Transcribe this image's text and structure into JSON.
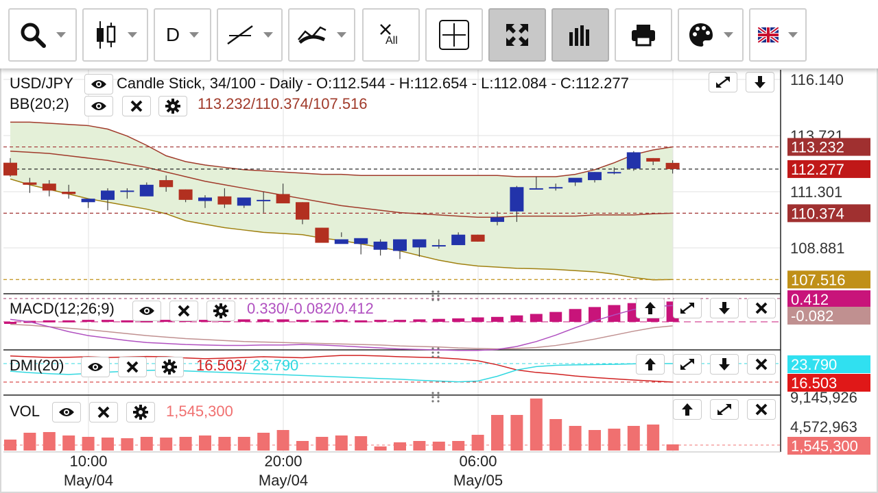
{
  "toolbar": {
    "timeframe_label": "D",
    "multi_all_label": "All",
    "buttons": [
      "search-tool",
      "chart-type",
      "timeframe",
      "drawing-tools",
      "indicators",
      "clear-all",
      "crosshair",
      "fullscreen",
      "volume-bars",
      "print",
      "theme",
      "language"
    ]
  },
  "header": {
    "symbol_line": "USD/JPY",
    "info_line": "Candle Stick, 34/100 - Daily - O:112.544 - H:112.654 - L:112.084 - C:112.277"
  },
  "indicators": {
    "bb": {
      "label": "BB(20;2)",
      "values": "113.232/110.374/107.516"
    },
    "macd": {
      "label": "MACD(12;26;9)",
      "values": "0.330/-0.082/0.412"
    },
    "dmi": {
      "label": "DMI(20)",
      "values_red": "16.503/",
      "values_cyan": "23.790"
    },
    "vol": {
      "label": "VOL",
      "values": "1,545,300"
    }
  },
  "colors": {
    "up": "#2233aa",
    "down": "#b23020",
    "upper_band": "#a03a2a",
    "middle_band": "#a03a2a",
    "lower_band": "#a08010",
    "band_fill": "#e4f0d8",
    "macd_line": "#b050c0",
    "signal_line": "#c09090",
    "histogram": "#c8147a",
    "dmi_plus": "#30d8e0",
    "dmi_minus": "#d02020",
    "volume": "#f07070"
  },
  "chart_data": {
    "type": "candlestick",
    "price_axis_ticks": [
      "116.140",
      "113.721",
      "111.301",
      "108.881"
    ],
    "price_tags": [
      {
        "label": "113.232",
        "value": 113.232,
        "color": "#a03030"
      },
      {
        "label": "112.277",
        "value": 112.277,
        "color": "#c01818"
      },
      {
        "label": "110.374",
        "value": 110.374,
        "color": "#a03030"
      },
      {
        "label": "107.516",
        "value": 107.516,
        "color": "#c09018"
      }
    ],
    "macd_tags": [
      {
        "label": "0.412",
        "color": "#c8147a"
      },
      {
        "label": "-0.082",
        "color": "#c09090"
      }
    ],
    "dmi_tags": [
      {
        "label": "23.790",
        "color": "#30e0f0"
      },
      {
        "label": "16.503",
        "color": "#e01818"
      }
    ],
    "vol_axis_ticks": [
      "9,145,926",
      "4,572,963"
    ],
    "vol_tag": {
      "label": "1,545,300",
      "color": "#f07070"
    },
    "time_ticks": [
      {
        "time": "10:00",
        "date": "May/04"
      },
      {
        "time": "20:00",
        "date": "May/04"
      },
      {
        "time": "06:00",
        "date": "May/05"
      }
    ],
    "ohlc": [
      [
        112.55,
        112.75,
        111.95,
        112.0
      ],
      [
        111.7,
        111.9,
        111.25,
        111.6
      ],
      [
        111.65,
        111.8,
        111.1,
        111.35
      ],
      [
        111.3,
        111.6,
        111.0,
        111.2
      ],
      [
        110.85,
        111.0,
        110.6,
        111.0
      ],
      [
        110.95,
        111.45,
        110.5,
        111.35
      ],
      [
        111.3,
        111.45,
        111.0,
        111.35
      ],
      [
        111.1,
        111.7,
        111.2,
        111.6
      ],
      [
        111.8,
        112.0,
        111.3,
        111.5
      ],
      [
        111.4,
        111.4,
        110.85,
        110.95
      ],
      [
        110.9,
        111.15,
        110.6,
        111.05
      ],
      [
        111.1,
        111.45,
        110.6,
        110.75
      ],
      [
        110.7,
        111.0,
        110.6,
        111.05
      ],
      [
        110.9,
        111.3,
        110.4,
        110.95
      ],
      [
        111.2,
        111.65,
        110.85,
        110.8
      ],
      [
        110.85,
        110.85,
        109.9,
        110.1
      ],
      [
        109.75,
        109.75,
        109.3,
        109.1
      ],
      [
        109.05,
        109.55,
        109.35,
        109.25
      ],
      [
        109.05,
        109.25,
        108.6,
        109.3
      ],
      [
        108.8,
        109.25,
        108.55,
        109.15
      ],
      [
        108.75,
        109.25,
        108.4,
        109.25
      ],
      [
        108.9,
        109.25,
        108.5,
        109.25
      ],
      [
        108.95,
        109.25,
        108.85,
        109.0
      ],
      [
        109.0,
        109.55,
        109.0,
        109.45
      ],
      [
        109.45,
        109.45,
        109.15,
        109.15
      ],
      [
        110.0,
        110.45,
        109.85,
        110.2
      ],
      [
        110.45,
        111.55,
        110.0,
        111.5
      ],
      [
        111.45,
        111.95,
        111.4,
        111.45
      ],
      [
        111.45,
        111.65,
        111.35,
        111.5
      ],
      [
        111.7,
        111.85,
        111.55,
        111.9
      ],
      [
        111.8,
        112.15,
        111.7,
        112.15
      ],
      [
        112.15,
        112.35,
        112.05,
        112.15
      ],
      [
        112.3,
        113.05,
        112.2,
        113.0
      ],
      [
        112.75,
        112.75,
        112.45,
        112.6
      ],
      [
        112.544,
        112.654,
        112.084,
        112.277
      ]
    ],
    "bb_upper": [
      114.3,
      114.3,
      114.25,
      114.2,
      114.15,
      114.0,
      113.7,
      113.3,
      112.85,
      112.6,
      112.45,
      112.35,
      112.25,
      112.2,
      112.15,
      112.1,
      112.05,
      112.05,
      112.0,
      112.0,
      112.0,
      112.0,
      112.0,
      112.0,
      112.0,
      112.0,
      111.95,
      111.95,
      111.95,
      112.05,
      112.25,
      112.55,
      112.9,
      113.1,
      113.232
    ],
    "bb_middle": [
      113.05,
      113.0,
      112.95,
      112.85,
      112.75,
      112.65,
      112.5,
      112.35,
      112.15,
      111.95,
      111.75,
      111.6,
      111.45,
      111.3,
      111.15,
      111.0,
      110.85,
      110.7,
      110.6,
      110.5,
      110.4,
      110.35,
      110.3,
      110.25,
      110.2,
      110.2,
      110.25,
      110.25,
      110.25,
      110.25,
      110.3,
      110.3,
      110.3,
      110.35,
      110.374
    ],
    "bb_lower": [
      111.85,
      111.6,
      111.4,
      111.2,
      111.0,
      110.85,
      110.7,
      110.55,
      110.35,
      110.05,
      109.9,
      109.75,
      109.65,
      109.55,
      109.5,
      109.45,
      109.3,
      109.2,
      109.05,
      108.9,
      108.75,
      108.55,
      108.35,
      108.2,
      108.1,
      108.05,
      108.0,
      107.98,
      107.95,
      107.9,
      107.85,
      107.75,
      107.6,
      107.5,
      107.516
    ],
    "macd": [
      0.05,
      0.0,
      -0.1,
      -0.2,
      -0.28,
      -0.33,
      -0.38,
      -0.42,
      -0.44,
      -0.46,
      -0.47,
      -0.48,
      -0.48,
      -0.47,
      -0.47,
      -0.46,
      -0.47,
      -0.49,
      -0.51,
      -0.53,
      -0.55,
      -0.56,
      -0.57,
      -0.58,
      -0.58,
      -0.56,
      -0.5,
      -0.4,
      -0.27,
      -0.12,
      0.02,
      0.14,
      0.25,
      0.31,
      0.33
    ],
    "signal": [
      -0.05,
      -0.07,
      -0.1,
      -0.13,
      -0.16,
      -0.2,
      -0.24,
      -0.28,
      -0.31,
      -0.34,
      -0.36,
      -0.38,
      -0.4,
      -0.41,
      -0.42,
      -0.43,
      -0.44,
      -0.45,
      -0.46,
      -0.47,
      -0.49,
      -0.5,
      -0.51,
      -0.53,
      -0.54,
      -0.55,
      -0.54,
      -0.52,
      -0.48,
      -0.42,
      -0.35,
      -0.27,
      -0.19,
      -0.12,
      -0.082
    ],
    "histogram": [
      0.0,
      0.02,
      0.03,
      0.03,
      0.04,
      0.04,
      0.03,
      0.03,
      0.04,
      0.04,
      0.04,
      0.04,
      0.05,
      0.05,
      0.05,
      0.04,
      0.03,
      0.04,
      0.03,
      0.04,
      0.04,
      0.05,
      0.06,
      0.07,
      0.09,
      0.1,
      0.13,
      0.16,
      0.2,
      0.26,
      0.3,
      0.34,
      0.38,
      0.41,
      0.412
    ],
    "dmi_plus": [
      20.8,
      20.2,
      19.8,
      19.5,
      19.9,
      20.4,
      20.8,
      21.1,
      21.3,
      20.9,
      20.6,
      20.3,
      20.0,
      19.7,
      19.4,
      19.1,
      18.8,
      18.5,
      18.2,
      17.9,
      17.6,
      17.2,
      16.9,
      16.6,
      16.9,
      18.8,
      21.3,
      22.6,
      23.1,
      23.3,
      23.4,
      23.5,
      23.7,
      23.79,
      23.79
    ],
    "dmi_minus": [
      26.8,
      26.5,
      26.2,
      26.3,
      26.5,
      26.2,
      26.4,
      26.6,
      26.5,
      26.0,
      25.7,
      25.9,
      26.2,
      26.5,
      26.3,
      26.1,
      26.6,
      27.0,
      27.0,
      26.8,
      26.5,
      26.3,
      26.1,
      25.6,
      24.9,
      23.3,
      21.3,
      20.3,
      19.7,
      18.9,
      18.3,
      17.8,
      17.3,
      16.9,
      16.503
    ],
    "volume": [
      1.6,
      2.6,
      2.7,
      2.2,
      2.0,
      1.9,
      1.8,
      2.0,
      1.9,
      2.0,
      2.2,
      2.0,
      2.0,
      2.6,
      3.0,
      1.4,
      2.0,
      2.2,
      2.1,
      0.6,
      1.2,
      1.4,
      1.3,
      1.4,
      2.3,
      5.2,
      5.2,
      7.6,
      4.6,
      3.6,
      3.0,
      3.2,
      3.6,
      3.8,
      0.9
    ]
  }
}
